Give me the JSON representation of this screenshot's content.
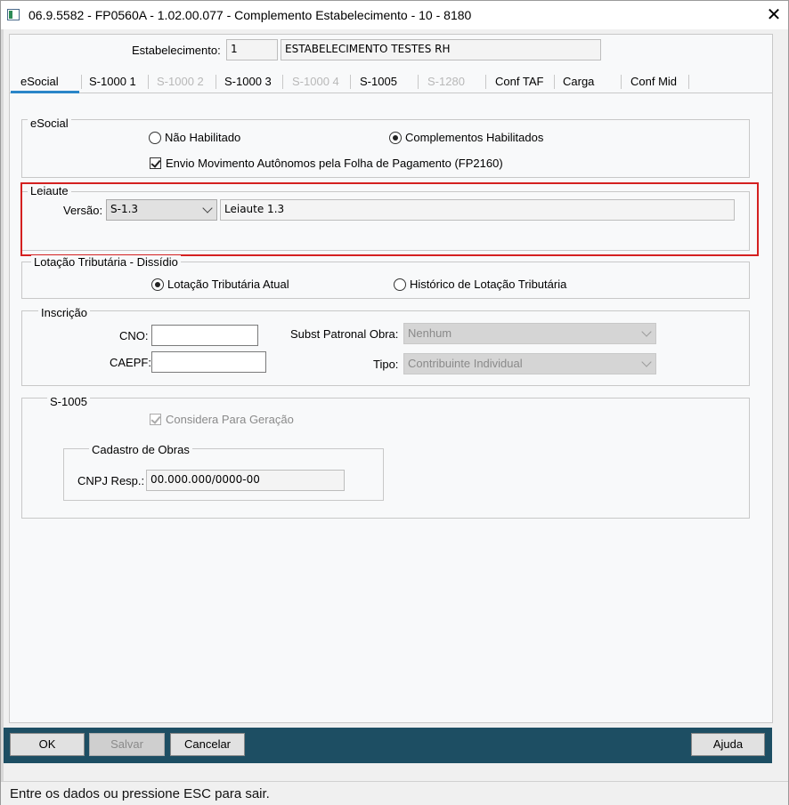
{
  "window": {
    "title": "06.9.5582 - FP0560A - 1.02.00.077 - Complemento Estabelecimento - 10 - 8180",
    "close_glyph": "✕"
  },
  "estabelecimento": {
    "label": "Estabelecimento:",
    "code": "1",
    "name": "ESTABELECIMENTO TESTES RH"
  },
  "tabs": [
    {
      "label": "eSocial",
      "active": true,
      "enabled": true
    },
    {
      "label": "S-1000 1",
      "enabled": true
    },
    {
      "label": "S-1000 2",
      "enabled": false
    },
    {
      "label": "S-1000 3",
      "enabled": true
    },
    {
      "label": "S-1000 4",
      "enabled": false
    },
    {
      "label": "S-1005",
      "enabled": true
    },
    {
      "label": "S-1280",
      "enabled": false
    },
    {
      "label": "Conf TAF",
      "enabled": true
    },
    {
      "label": "Carga",
      "enabled": true
    },
    {
      "label": "Conf Mid",
      "enabled": true
    }
  ],
  "esocial_group": {
    "legend": "eSocial",
    "radio_nao": "Não Habilitado",
    "radio_comp": "Complementos Habilitados",
    "selected": "Complementos Habilitados",
    "checkbox_envio": "Envio Movimento Autônomos pela Folha de Pagamento (FP2160)",
    "checkbox_envio_checked": true
  },
  "leiaute_group": {
    "legend": "Leiaute",
    "versao_label": "Versão:",
    "versao_value": "S-1.3",
    "descricao": "Leiaute 1.3"
  },
  "lotacao_group": {
    "legend": "Lotação Tributária - Dissídio",
    "radio_atual": "Lotação Tributária Atual",
    "radio_historico": "Histórico de Lotação Tributária",
    "selected": "Lotação Tributária Atual"
  },
  "inscricao_group": {
    "legend": "Inscrição",
    "cno_label": "CNO:",
    "cno_value": "",
    "caepf_label": "CAEPF:",
    "caepf_value": "",
    "subst_label": "Subst Patronal Obra:",
    "subst_value": "Nenhum",
    "tipo_label": "Tipo:",
    "tipo_value": "Contribuinte Individual"
  },
  "s1005_group": {
    "legend": "S-1005",
    "considera_label": "Considera Para Geração",
    "considera_checked": true,
    "cadastro_legend": "Cadastro de Obras",
    "cnpj_label": "CNPJ Resp.:",
    "cnpj_value": "00.000.000/0000-00"
  },
  "buttons": {
    "ok": "OK",
    "salvar": "Salvar",
    "cancelar": "Cancelar",
    "ajuda": "Ajuda"
  },
  "status": {
    "text": "Entre os dados ou pressione ESC para sair."
  },
  "colors": {
    "footer_bg": "#1d4e63",
    "tab_accent": "#2a86c8",
    "highlight_border": "#d42020"
  }
}
